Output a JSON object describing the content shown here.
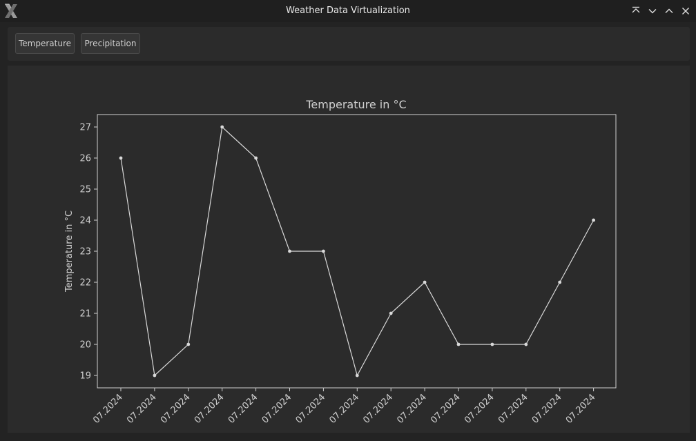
{
  "window": {
    "title": "Weather Data Virtualization"
  },
  "icons": {
    "logo": "x-logo-icon",
    "controls": [
      "keep-above-icon",
      "minimize-icon",
      "maximize-icon",
      "close-icon"
    ]
  },
  "toolbar": {
    "temperature_label": "Temperature",
    "precipitation_label": "Precipitation"
  },
  "colors": {
    "background": "#2b2b2b",
    "line": "#d9d9d9",
    "text": "#cfcfcf"
  },
  "chart_data": {
    "type": "line",
    "title": "Temperature in °C",
    "xlabel": "",
    "ylabel": "Temperature in °C",
    "categories": [
      "07.2024",
      "07.2024",
      "07.2024",
      "07.2024",
      "07.2024",
      "07.2024",
      "07.2024",
      "07.2024",
      "07.2024",
      "07.2024",
      "07.2024",
      "07.2024",
      "07.2024",
      "07.2024",
      "07.2024"
    ],
    "values": [
      26,
      19,
      20,
      27,
      26,
      23,
      23,
      19,
      21,
      22,
      20,
      20,
      20,
      22,
      24
    ],
    "yticks": [
      19,
      20,
      21,
      22,
      23,
      24,
      25,
      26,
      27
    ],
    "ylim": [
      18.6,
      27.4
    ],
    "grid": false,
    "markers": true
  }
}
